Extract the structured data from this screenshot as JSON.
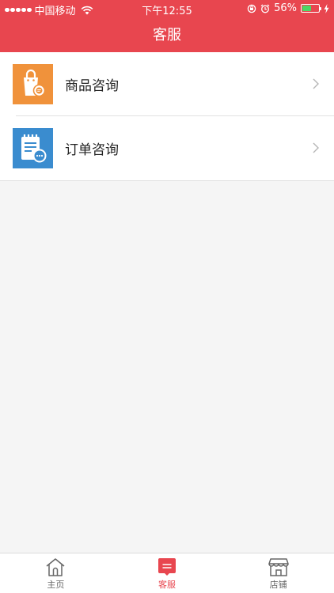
{
  "status_bar": {
    "carrier": "中国移动",
    "time": "下午12:55",
    "battery_percent": "56%",
    "battery_level": 0.56
  },
  "nav": {
    "title": "客服"
  },
  "menu": {
    "items": [
      {
        "label": "商品咨询",
        "icon": "shopping-bag-icon",
        "color": "#f0923b"
      },
      {
        "label": "订单咨询",
        "icon": "order-list-icon",
        "color": "#3a8ccf"
      }
    ]
  },
  "tabbar": {
    "tabs": [
      {
        "label": "主页",
        "icon": "home-icon",
        "active": false
      },
      {
        "label": "客服",
        "icon": "chat-icon",
        "active": true
      },
      {
        "label": "店铺",
        "icon": "store-icon",
        "active": false
      }
    ]
  },
  "colors": {
    "brand_red": "#e8464f",
    "page_bg": "#f5f5f5"
  }
}
